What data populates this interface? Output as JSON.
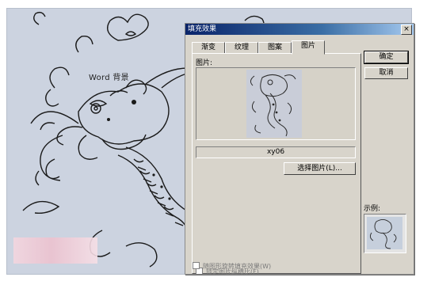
{
  "background": {
    "label": "Word 背景"
  },
  "dialog": {
    "title": "填充效果",
    "close_glyph": "×",
    "tabs": [
      {
        "label": "渐变",
        "active": false
      },
      {
        "label": "纹理",
        "active": false
      },
      {
        "label": "图案",
        "active": false
      },
      {
        "label": "图片",
        "active": true
      }
    ],
    "picture_label": "图片:",
    "file_name": "xy06",
    "select_picture_button": "选择图片(L)...",
    "lock_aspect_checkbox": {
      "label": "锁定图片纵横比(F)",
      "checked": false
    },
    "rotate_with_shape_checkbox": {
      "label": "随图形旋转填充效果(W)",
      "checked": false
    },
    "ok_button": "确定",
    "cancel_button": "取消",
    "sample_label": "示例:"
  },
  "colors": {
    "title_start": "#0a246a",
    "title_end": "#a6caf0",
    "dialog_face": "#d8d4cb",
    "background_doc": "#ccd3e0"
  }
}
